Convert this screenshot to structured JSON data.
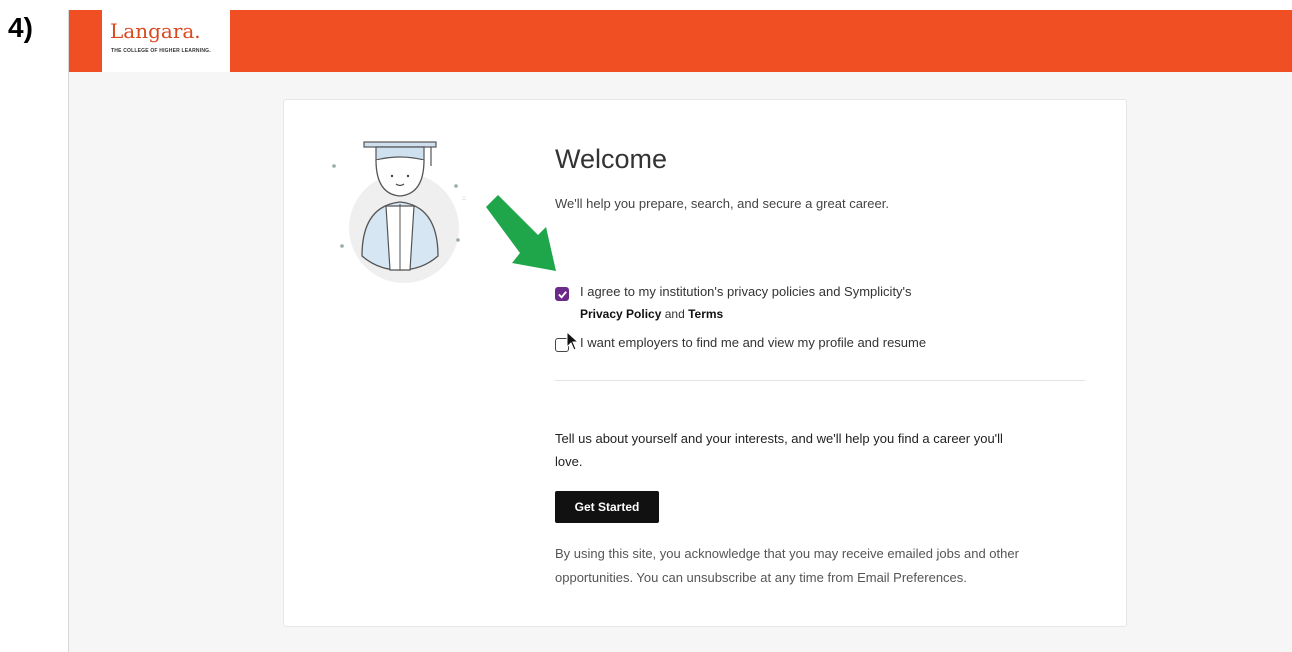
{
  "step_label": "4)",
  "header": {
    "logo_text": "Langara.",
    "logo_tagline": "THE COLLEGE OF HIGHER LEARNING.",
    "bar_color": "#ef4f23"
  },
  "welcome": {
    "title": "Welcome",
    "subtitle": "We'll help you prepare, search, and secure a great career."
  },
  "consent": {
    "agree_line1": "I agree to my institution's privacy policies and Symplicity's",
    "privacy_policy_link": "Privacy Policy",
    "and_text": " and ",
    "terms_link": "Terms",
    "agree_checked": true,
    "employers_label": "I want employers to find me and view my profile and resume",
    "employers_checked": false,
    "checkbox_color": "#6b2a8a"
  },
  "intro": {
    "line1": "Tell us about yourself and your interests, and we'll help you find a career you'll",
    "line2": "love."
  },
  "get_started_label": "Get Started",
  "legal": {
    "line1": "By using this site, you acknowledge that you may receive emailed jobs and other",
    "line2": "opportunities. You can unsubscribe at any time from Email Preferences."
  },
  "annotation": {
    "arrow_icon": "green-arrow-icon",
    "arrow_color": "#1fa64a"
  }
}
